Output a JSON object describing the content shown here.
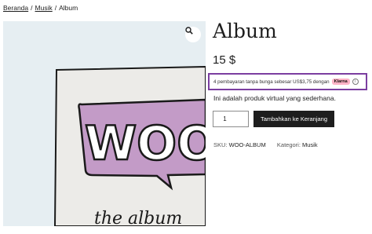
{
  "breadcrumb": {
    "home": "Beranda",
    "category": "Musik",
    "current": "Album",
    "separator": "/"
  },
  "gallery": {
    "image_text": "WOO",
    "image_caption": "the album",
    "zoom_icon": "magnifier-icon"
  },
  "product": {
    "title": "Album",
    "price": "15 $",
    "description": "Ini adalah produk virtual yang sederhana.",
    "quantity": "1",
    "add_to_cart_label": "Tambahkan ke Keranjang"
  },
  "klarna": {
    "message": "4 pembayaran tanpa bunga sebesar US$3,75 dengan",
    "badge": "Klarna",
    "info_icon": "info-icon",
    "border_color": "#7b3ea0",
    "badge_color": "#ffb3c7"
  },
  "meta": {
    "sku_label": "SKU:",
    "sku_value": "WOO-ALBUM",
    "category_label": "Kategori:",
    "category_value": "Musik"
  }
}
